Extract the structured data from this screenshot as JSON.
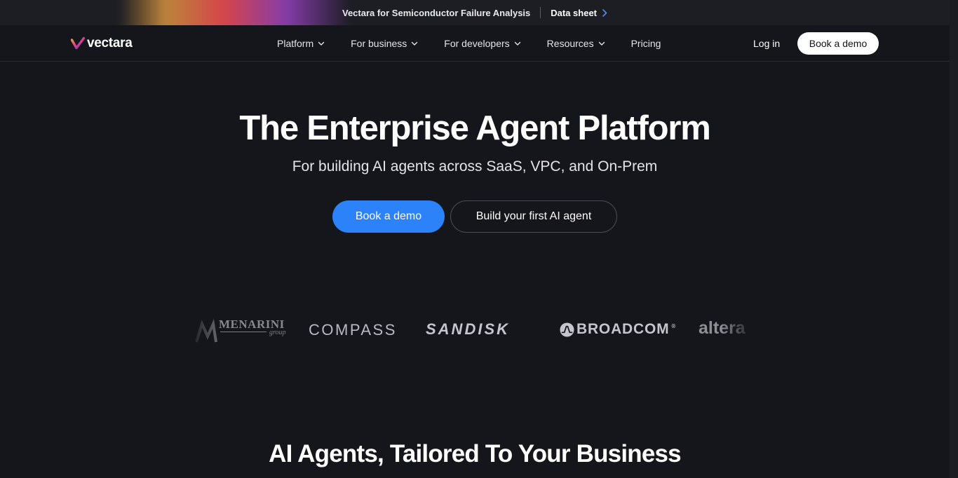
{
  "announcement": {
    "text": "Vectara for Semiconductor Failure Analysis",
    "link_label": "Data sheet",
    "link_icon": "chevron-right-icon"
  },
  "nav": {
    "logo_text": "vectara",
    "items": [
      {
        "label": "Platform",
        "has_dropdown": true
      },
      {
        "label": "For business",
        "has_dropdown": true
      },
      {
        "label": "For developers",
        "has_dropdown": true
      },
      {
        "label": "Resources",
        "has_dropdown": true
      },
      {
        "label": "Pricing",
        "has_dropdown": false
      }
    ],
    "login_label": "Log in",
    "demo_label": "Book a demo"
  },
  "hero": {
    "title": "The Enterprise Agent Platform",
    "subtitle": "For building AI agents across SaaS, VPC, and On-Prem",
    "primary_cta": "Book a demo",
    "secondary_cta": "Build your first AI agent"
  },
  "customer_logos": {
    "menarini": {
      "name": "MENARINI",
      "tagline": "group"
    },
    "compass": "COMPASS",
    "sandisk": "SANDISK",
    "broadcom": "BROADCOM",
    "altera": "altera"
  },
  "section": {
    "title": "AI Agents, Tailored To Your Business"
  },
  "colors": {
    "background": "#15161b",
    "primary_button": "#2c82f8",
    "announcement_link_chevron": "#4d8bff"
  }
}
